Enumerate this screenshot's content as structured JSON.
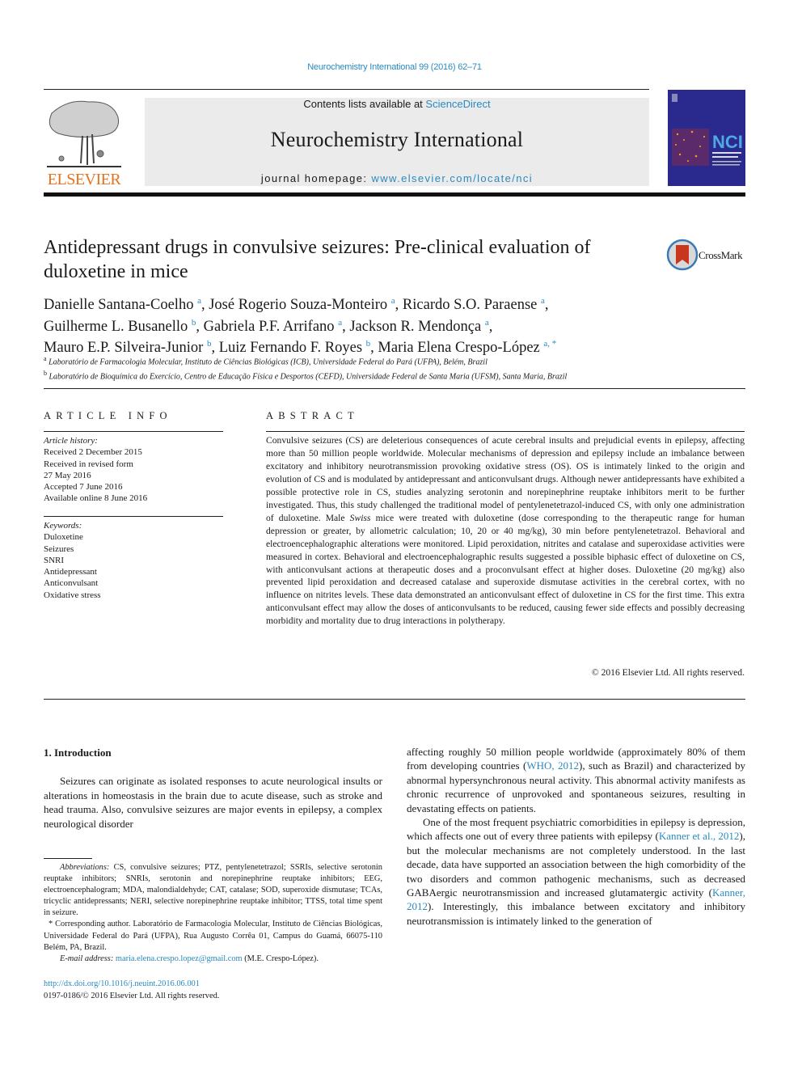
{
  "header": {
    "citation": "Neurochemistry International 99 (2016) 62–71",
    "contents_prefix": "Contents lists available at ",
    "contents_link": "ScienceDirect",
    "journal_name": "Neurochemistry International",
    "homepage_prefix": "journal homepage: ",
    "homepage_link": "www.elsevier.com/locate/nci",
    "publisher_logo_text": "ELSEVIER",
    "cover_label": "NCI",
    "crossmark_label": "CrossMark",
    "colors": {
      "link": "#2a8ac0",
      "elsevier_orange": "#e9711c",
      "cover_blue": "#2a2a8e",
      "banner_gray": "#ebebeb"
    }
  },
  "article": {
    "title": "Antidepressant drugs in convulsive seizures: Pre-clinical evaluation of duloxetine in mice",
    "authors": [
      {
        "name": "Danielle Santana-Coelho",
        "aff": "a"
      },
      {
        "name": "José Rogerio Souza-Monteiro",
        "aff": "a"
      },
      {
        "name": "Ricardo S.O. Paraense",
        "aff": "a"
      },
      {
        "name": "Guilherme L. Busanello",
        "aff": "b"
      },
      {
        "name": "Gabriela P.F. Arrifano",
        "aff": "a"
      },
      {
        "name": "Jackson R. Mendonça",
        "aff": "a"
      },
      {
        "name": "Mauro E.P. Silveira-Junior",
        "aff": "b"
      },
      {
        "name": "Luiz Fernando F. Royes",
        "aff": "b"
      },
      {
        "name": "Maria Elena Crespo-López",
        "aff": "a, *"
      }
    ],
    "affiliations": [
      {
        "mark": "a",
        "text": "Laboratório de Farmacologia Molecular, Instituto de Ciências Biológicas (ICB), Universidade Federal do Pará (UFPA), Belém, Brazil"
      },
      {
        "mark": "b",
        "text": "Laboratório de Bioquímica do Exercício, Centro de Educação Física e Desportos (CEFD), Universidade Federal de Santa Maria (UFSM), Santa Maria, Brazil"
      }
    ]
  },
  "article_info": {
    "heading": "ARTICLE INFO",
    "history_label": "Article history:",
    "history": [
      "Received 2 December 2015",
      "Received in revised form",
      "27 May 2016",
      "Accepted 7 June 2016",
      "Available online 8 June 2016"
    ],
    "keywords_label": "Keywords:",
    "keywords": [
      "Duloxetine",
      "Seizures",
      "SNRI",
      "Antidepressant",
      "Anticonvulsant",
      "Oxidative stress"
    ]
  },
  "abstract": {
    "heading": "ABSTRACT",
    "text_a": "Convulsive seizures (CS) are deleterious consequences of acute cerebral insults and prejudicial events in epilepsy, affecting more than 50 million people worldwide. Molecular mechanisms of depression and epilepsy include an imbalance between excitatory and inhibitory neurotransmission provoking oxidative stress (OS). OS is intimately linked to the origin and evolution of CS and is modulated by antidepressant and anticonvulsant drugs. Although newer antidepressants have exhibited a possible protective role in CS, studies analyzing serotonin and norepinephrine reuptake inhibitors merit to be further investigated. Thus, this study challenged the traditional model of pentylenetetrazol-induced CS, with only one administration of duloxetine. Male ",
    "text_italic": "Swiss",
    "text_b": " mice were treated with duloxetine (dose corresponding to the therapeutic range for human depression or greater, by allometric calculation; 10, 20 or 40 mg/kg), 30 min before pentylenetetrazol. Behavioral and electroencephalographic alterations were monitored. Lipid peroxidation, nitrites and catalase and superoxidase activities were measured in cortex. Behavioral and electroencephalographic results suggested a possible biphasic effect of duloxetine on CS, with anticon­vulsant actions at therapeutic doses and a proconvulsant effect at higher doses. Duloxetine (20 mg/kg) also prevented lipid peroxidation and decreased catalase and superoxide dismutase activities in the cerebral cortex, with no influence on nitrites levels. These data demonstrated an anticonvulsant effect of duloxetine in CS for the first time. This extra anticonvulsant effect may allow the doses of anticonvulsants to be reduced, causing fewer side effects and possibly decreasing morbidity and mortality due to drug interactions in polytherapy.",
    "copyright": "© 2016 Elsevier Ltd. All rights reserved."
  },
  "body": {
    "section_heading": "1.  Introduction",
    "intro_p1": "Seizures can originate as isolated responses to acute neurolog­ical insults or alterations in homeostasis in the brain due to acute disease, such as stroke and head trauma. Also, convulsive seizures are major events in epilepsy, a complex neurological disorder",
    "col2_p1_a": "affecting roughly 50 million people worldwide (approximately 80% of them from developing countries (",
    "col2_p1_ref": "WHO, 2012",
    "col2_p1_b": "), such as Brazil) and characterized by abnormal hypersynchronous neural activity. This abnormal activity manifests as chronic recurrence of unpro­voked and spontaneous seizures, resulting in devastating effects on patients.",
    "col2_p2_a": "One of the most frequent psychiatric comorbidities in epilepsy is depression, which affects one out of every three patients with ep­ilepsy (",
    "col2_p2_ref1": "Kanner et al., 2012",
    "col2_p2_b": "), but the molecular mechanisms are not completely understood. In the last decade, data have supported an association between the high comorbidity of the two disorders and common pathogenic mechanisms, such as decreased GABAergic neurotransmission and increased glutamatergic activity (",
    "col2_p2_ref2": "Kanner, 2012",
    "col2_p2_c": "). Interestingly, this imbalance between excitatory and inhib­itory neurotransmission is intimately linked to the generation of"
  },
  "footnotes": {
    "abbrev_label": "Abbreviations:",
    "abbrev_text": " CS, convulsive seizures; PTZ, pentylenetetrazol; SSRIs, selective serotonin reuptake inhibitors; SNRIs, serotonin and norepinephrine reuptake in­hibitors; EEG, electroencephalogram; MDA, malondialdehyde; CAT, catalase; SOD, superoxide dismutase; TCAs, tricyclic antidepressants; NERI, selective norepi­nephrine reuptake inhibitor; TTSS, total time spent in seizure.",
    "corresponding": "* Corresponding author. Laboratório de Farmacologia Molecular, Instituto de Ciências Biológicas, Universidade Federal do Pará (UFPA), Rua Augusto Corrêa 01, Campus do Guamá, 66075-110 Belém, PA, Brazil.",
    "email_label": "E-mail address:",
    "email": "maria.elena.crespo.lopez@gmail.com",
    "email_suffix": " (M.E. Crespo-López).",
    "doi": "http://dx.doi.org/10.1016/j.neuint.2016.06.001",
    "issn": "0197-0186/© 2016 Elsevier Ltd. All rights reserved."
  }
}
